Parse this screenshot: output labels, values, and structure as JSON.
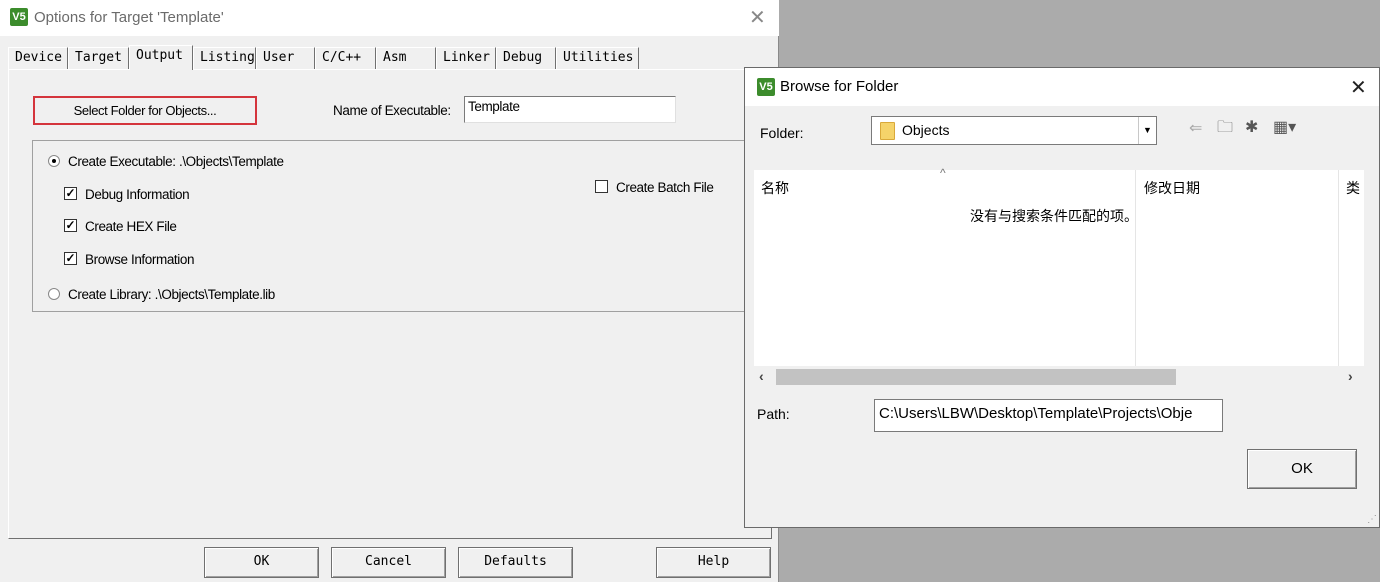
{
  "options_dialog": {
    "title": "Options for Target 'Template'",
    "app_icon_text": "V5",
    "tabs": [
      "Device",
      "Target",
      "Output",
      "Listing",
      "User",
      "C/C++",
      "Asm",
      "Linker",
      "Debug",
      "Utilities"
    ],
    "active_tab": "Output",
    "select_folder_label": "Select Folder for Objects...",
    "name_exe_label": "Name of Executable:",
    "name_exe_value": "Template",
    "create_exe_label": "Create Executable:  .\\Objects\\Template",
    "debug_info_label": "Debug Information",
    "create_hex_label": "Create HEX File",
    "browse_info_label": "Browse Information",
    "create_lib_label": "Create Library:  .\\Objects\\Template.lib",
    "create_batch_label": "Create Batch File",
    "buttons": {
      "ok": "OK",
      "cancel": "Cancel",
      "defaults": "Defaults",
      "help": "Help"
    }
  },
  "browse_dialog": {
    "title": "Browse for Folder",
    "folder_label": "Folder:",
    "folder_value": "Objects",
    "col_name": "名称",
    "col_date": "修改日期",
    "col_type": "类",
    "empty_message": "没有与搜索条件匹配的项。",
    "path_label": "Path:",
    "path_value": "C:\\Users\\LBW\\Desktop\\Template\\Projects\\Obje",
    "ok_label": "OK"
  },
  "colors": {
    "highlight_border": "#d4343c",
    "app_icon": "#3c8c2c",
    "folder": "#f5d36a"
  }
}
